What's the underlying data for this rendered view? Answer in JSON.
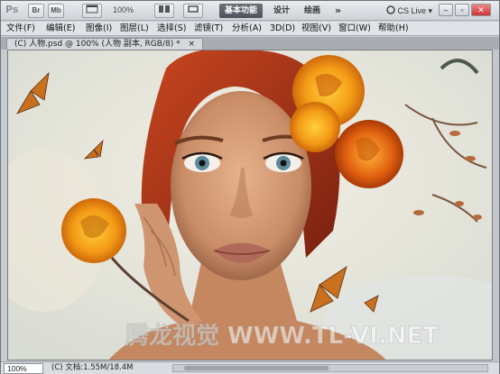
{
  "titlebar": {
    "app_logo": "Ps",
    "br_label": "Br",
    "mb_label": "Mb",
    "zoom_value": "100%",
    "workspaces": [
      {
        "label": "基本功能",
        "active": true
      },
      {
        "label": "设计",
        "active": false
      },
      {
        "label": "绘画",
        "active": false
      },
      {
        "label": "»",
        "active": false
      }
    ],
    "cs_live": "CS Live",
    "window_buttons": [
      "–",
      "▫",
      "✕"
    ]
  },
  "menu": [
    {
      "label": "文件(F)"
    },
    {
      "label": "编辑(E)"
    },
    {
      "label": "图像(I)"
    },
    {
      "label": "图层(L)"
    },
    {
      "label": "选择(S)"
    },
    {
      "label": "滤镜(T)"
    },
    {
      "label": "分析(A)"
    },
    {
      "label": "3D(D)"
    },
    {
      "label": "视图(V)"
    },
    {
      "label": "窗口(W)"
    },
    {
      "label": "帮助(H)"
    }
  ],
  "document": {
    "tab_label": "(C) 人物.psd @ 100% (人物 副本, RGB/8) *",
    "tab_close": "×",
    "watermark": "腾龙视觉 WWW.TL-VI.NET"
  },
  "status": {
    "zoom": "100%",
    "info": "(C) 文档:1.55M/18.4M"
  },
  "colors": {
    "accent_workspace": "#4e545b",
    "canvas_bg": "#eaeae4",
    "hair": "#b43a1e",
    "rose": "#f2a21a"
  }
}
